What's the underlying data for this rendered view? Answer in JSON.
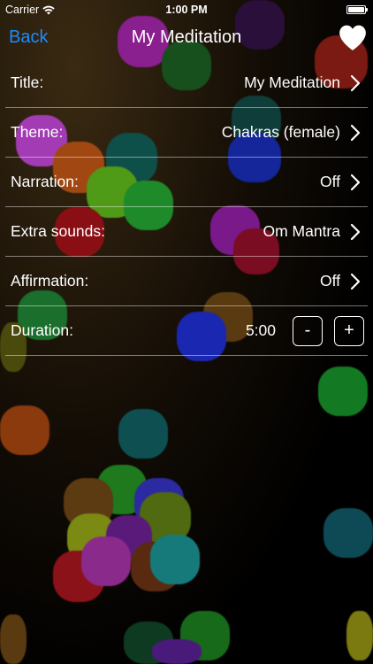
{
  "status_bar": {
    "carrier": "Carrier",
    "time": "1:00 PM",
    "wifi_icon": "wifi-icon",
    "battery_icon": "battery-icon"
  },
  "nav": {
    "back_label": "Back",
    "title": "My Meditation",
    "favorite_icon": "heart-icon"
  },
  "settings": [
    {
      "label": "Title:",
      "value": "My Meditation"
    },
    {
      "label": "Theme:",
      "value": "Chakras (female)"
    },
    {
      "label": "Narration:",
      "value": "Off"
    },
    {
      "label": "Extra sounds:",
      "value": "Om Mantra"
    },
    {
      "label": "Affirmation:",
      "value": "Off"
    }
  ],
  "duration": {
    "label": "Duration:",
    "value": "5:00",
    "decrement_label": "-",
    "increment_label": "+"
  },
  "colors": {
    "accent": "#1a8cff",
    "text": "#ffffff",
    "background": "#000000"
  }
}
